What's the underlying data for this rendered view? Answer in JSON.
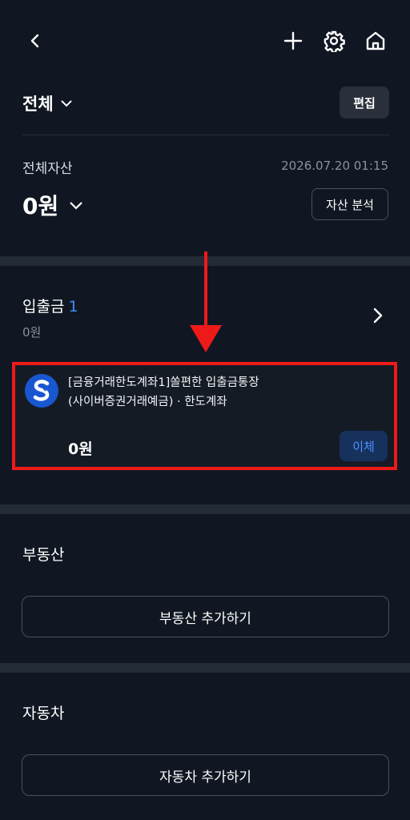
{
  "nav": {
    "back_icon": "chevron-left-icon",
    "add_icon": "plus-icon",
    "settings_icon": "gear-icon",
    "home_icon": "home-icon"
  },
  "group": {
    "title": "전체",
    "edit_label": "편집"
  },
  "total_assets": {
    "label": "전체자산",
    "timestamp": "2026.07.20 01:15",
    "value": "0원",
    "analysis_button": "자산 분석"
  },
  "deposits": {
    "title": "입출금",
    "count": "1",
    "subtotal": "0원",
    "account": {
      "name_line1": "[금융거래한도계좌1]쏠편한 입출금통장",
      "name_line2": "(사이버증권거래예금) · 한도계좌",
      "balance": "0원",
      "transfer_label": "이체",
      "logo_icon": "shinhan-bank-logo"
    }
  },
  "real_estate": {
    "title": "부동산",
    "add_label": "부동산 추가하기"
  },
  "car": {
    "title": "자동차",
    "add_label": "자동차 추가하기"
  },
  "colors": {
    "background": "#111722",
    "accent_blue": "#3f8cff",
    "highlight_red": "#ee1a1a",
    "logo_blue": "#1957d1"
  }
}
